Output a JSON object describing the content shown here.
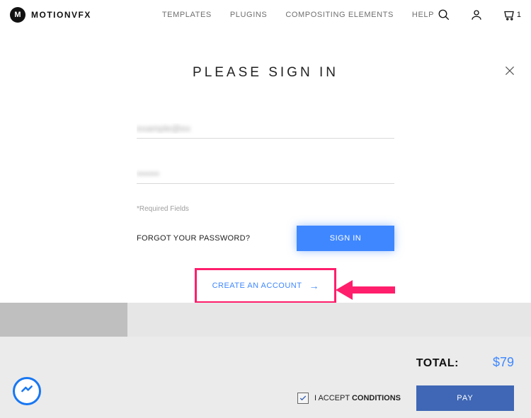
{
  "brand": "MOTIONVFX",
  "logo_letter": "M",
  "nav": [
    "TEMPLATES",
    "PLUGINS",
    "COMPOSITING ELEMENTS",
    "HELP"
  ],
  "cart_count": "1",
  "modal": {
    "title": "PLEASE SIGN IN",
    "email_value": "example@ex",
    "password_value": "•••••••",
    "required_note": "*Required Fields",
    "forgot": "FORGOT YOUR PASSWORD?",
    "signin": "SIGN IN",
    "create": "CREATE AN ACCOUNT",
    "create_arrow": "→"
  },
  "checkout": {
    "total_label": "TOTAL:",
    "total_amount": "$79",
    "accept_prefix": "I ACCEPT ",
    "accept_bold": "CONDITIONS",
    "pay": "PAY"
  }
}
